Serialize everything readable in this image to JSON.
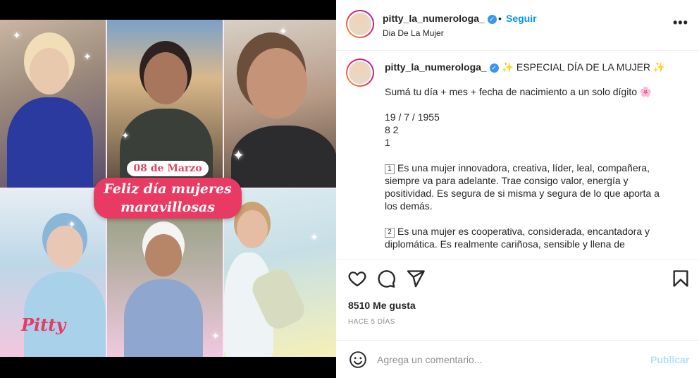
{
  "post_image": {
    "date_label": "08 de Marzo",
    "greeting_line1": "Feliz día mujeres",
    "greeting_line2": "maravillosas",
    "brand": "Pitty"
  },
  "header": {
    "username": "pitty_la_numerologa_",
    "separator": "•",
    "follow_label": "Seguir",
    "location": "Dia De La Mujer",
    "more_icon": "more-options-icon"
  },
  "caption": {
    "username": "pitty_la_numerologa_",
    "title": "✨ ESPECIAL DÍA DE LA MUJER ✨",
    "lines": [
      "Sumá tu día + mes + fecha de nacimiento a un solo dígito 🌸",
      "",
      "19 / 7 / 1955",
      "8 2",
      "1",
      ""
    ],
    "item1_num": "1",
    "item1_text": "Es una mujer innovadora, creativa, líder, leal, compañera, siempre va para adelante. Trae consigo valor, energía y positividad. Es segura de si misma y segura de lo que aporta a los demás.",
    "item2_num": "2",
    "item2_text": "Es una mujer es cooperativa, considerada, encantadora y diplomática. Es realmente cariñosa, sensible y llena de"
  },
  "actions": {
    "like_icon": "heart-icon",
    "comment_icon": "comment-icon",
    "share_icon": "share-icon",
    "save_icon": "bookmark-icon"
  },
  "stats": {
    "likes": "8510 Me gusta",
    "time_ago": "HACE 5 DÍAS"
  },
  "comment": {
    "placeholder": "Agrega un comentario...",
    "publish_label": "Publicar"
  },
  "colors": {
    "link_blue": "#0095f6",
    "publish_disabled": "#b2dffc",
    "banner_pink": "#e83a62",
    "verified_blue": "#3897f0"
  }
}
